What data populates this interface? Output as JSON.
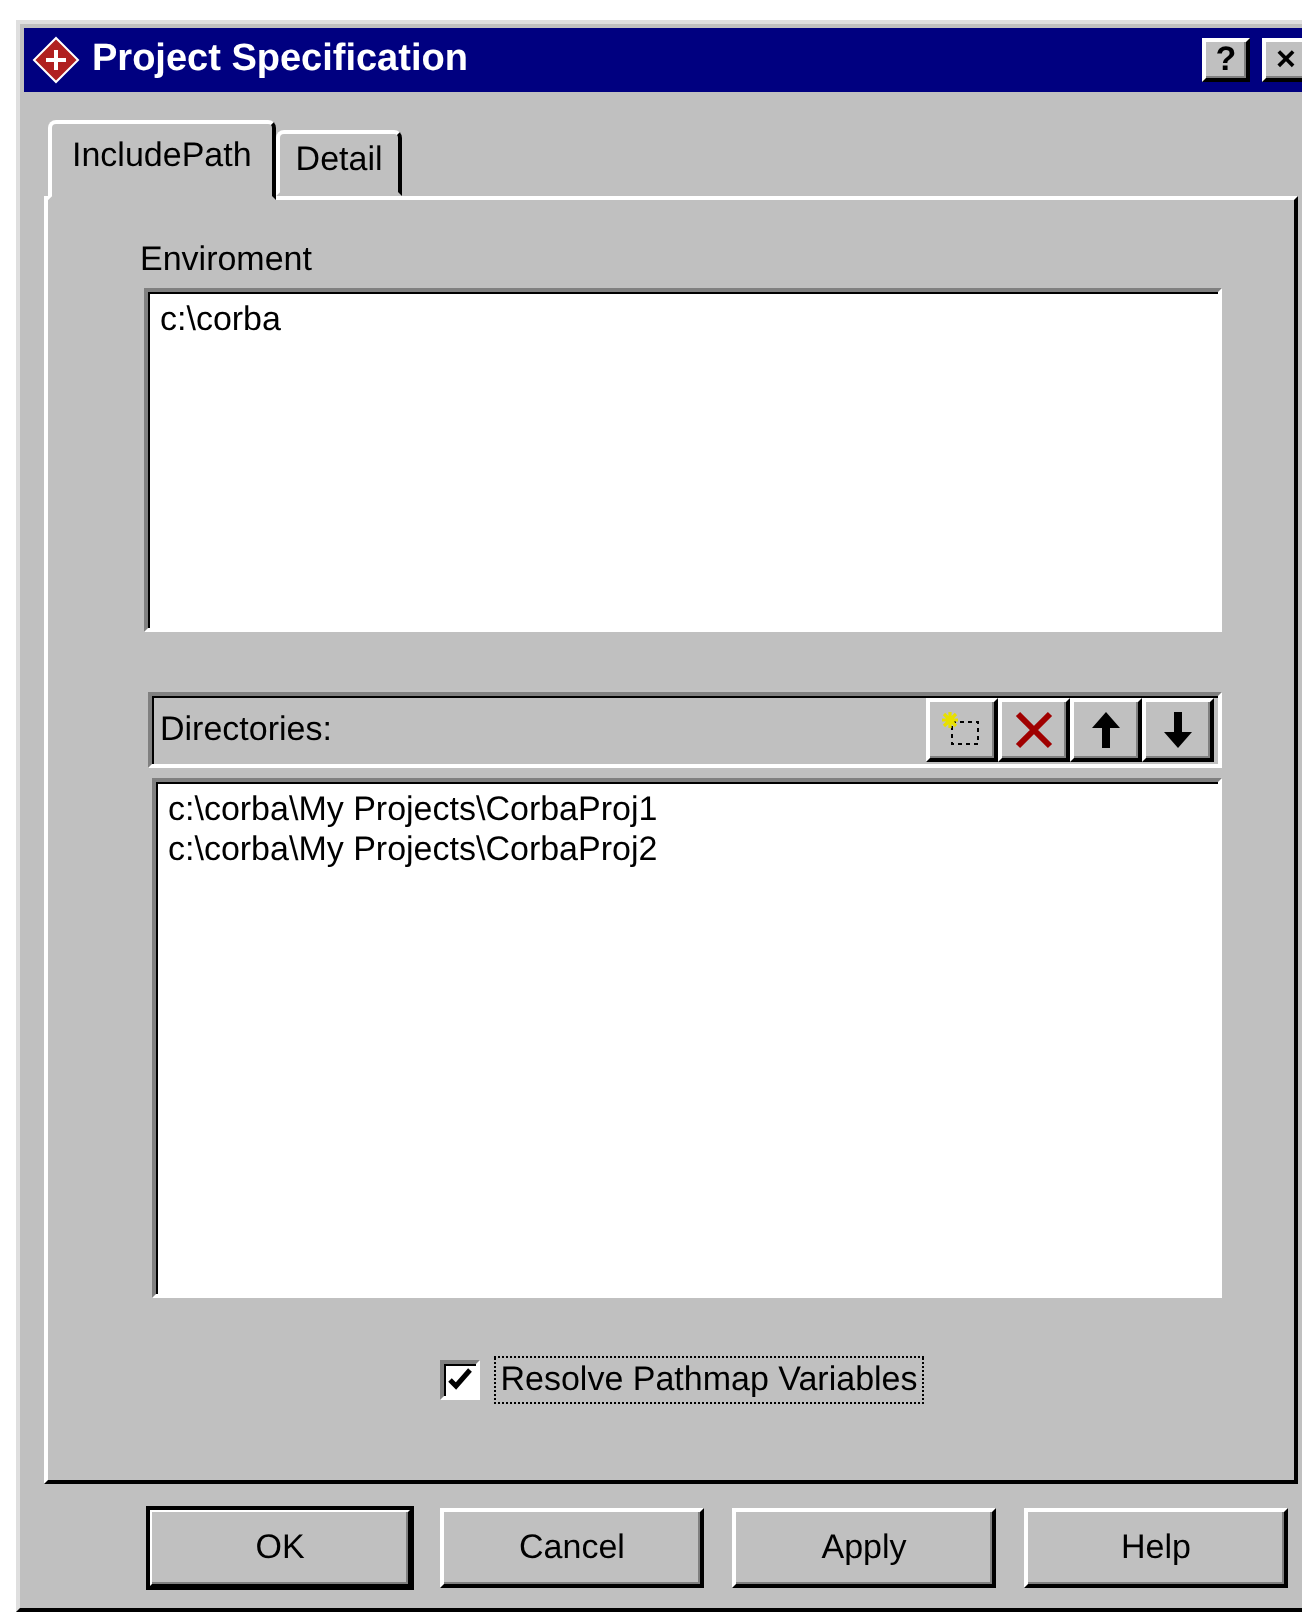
{
  "window": {
    "title": "Project Specification",
    "help_button": "?",
    "close_button": "×"
  },
  "tabs": [
    {
      "label": "IncludePath",
      "selected": true
    },
    {
      "label": "Detail",
      "selected": false
    }
  ],
  "environment": {
    "label": "Enviroment",
    "lines": [
      "c:\\corba"
    ]
  },
  "directories": {
    "label": "Directories:",
    "tools": [
      {
        "kind": "new"
      },
      {
        "kind": "delete"
      },
      {
        "kind": "up"
      },
      {
        "kind": "down"
      }
    ],
    "items": [
      "c:\\corba\\My Projects\\CorbaProj1",
      "c:\\corba\\My Projects\\CorbaProj2"
    ]
  },
  "option": {
    "label": "Resolve Pathmap Variables",
    "checked": true,
    "focused": true
  },
  "buttons": [
    {
      "label": "OK",
      "default": true
    },
    {
      "label": "Cancel",
      "default": false
    },
    {
      "label": "Apply",
      "default": false
    },
    {
      "label": "Help",
      "default": false
    }
  ]
}
